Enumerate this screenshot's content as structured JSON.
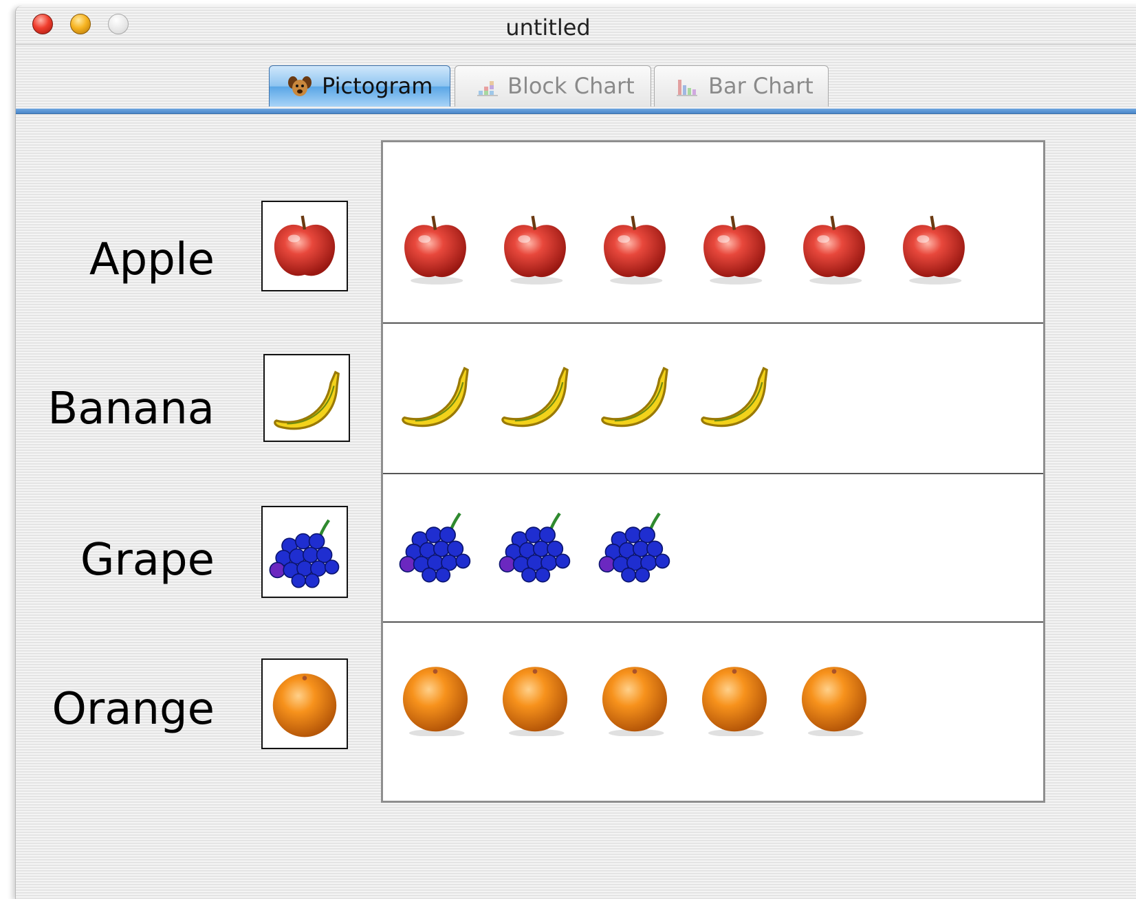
{
  "window": {
    "title": "untitled"
  },
  "tabs": [
    {
      "label": "Pictogram",
      "selected": true,
      "icon": "dog-face-icon"
    },
    {
      "label": "Block Chart",
      "selected": false,
      "icon": "block-chart-icon"
    },
    {
      "label": "Bar Chart",
      "selected": false,
      "icon": "bar-chart-icon"
    }
  ],
  "chart_data": {
    "type": "pictogram",
    "categories": [
      "Apple",
      "Banana",
      "Grape",
      "Orange"
    ],
    "values": [
      6,
      4,
      3,
      5
    ],
    "icons": [
      "apple-icon",
      "banana-icon",
      "grape-icon",
      "orange-icon"
    ],
    "colors": {
      "apple": "#d92f2a",
      "banana": "#f3d21b",
      "grape": "#1f2ed0",
      "orange": "#f7921c"
    }
  }
}
